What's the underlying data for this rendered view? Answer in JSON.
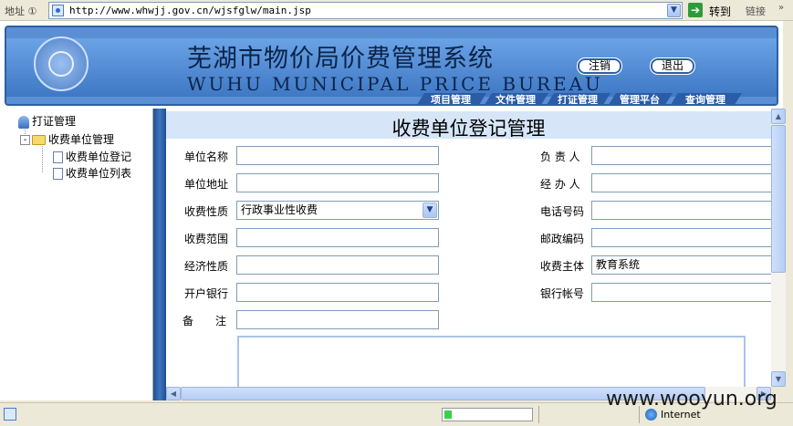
{
  "address_bar": {
    "label": "地址 ①",
    "url": "http://www.whwjj.gov.cn/wjsfglw/main.jsp",
    "go_label": "转到",
    "links_label": "链接"
  },
  "header": {
    "title": "芜湖市物价局价费管理系统",
    "subtitle": "WUHU MUNICIPAL PRICE BUREAU",
    "logout_label": "注销",
    "exit_label": "退出",
    "tabs": [
      "项目管理",
      "文件管理",
      "打证管理",
      "管理平台",
      "查询管理"
    ]
  },
  "nav": {
    "root_label": "打证管理",
    "group_toggle": "-",
    "group_label": "收费单位管理",
    "items": [
      "收费单位登记",
      "收费单位列表"
    ]
  },
  "form": {
    "title": "收费单位登记管理",
    "fields": {
      "unit_name_label": "单位名称",
      "unit_address_label": "单位地址",
      "fee_nature_label": "收费性质",
      "fee_nature_value": "行政事业性收费",
      "fee_scope_label": "收费范围",
      "economic_nature_label": "经济性质",
      "bank_label": "开户银行",
      "notes_label": "备　　注",
      "person_in_charge_label": "负 责 人",
      "handler_label": "经 办 人",
      "phone_label": "电话号码",
      "postcode_label": "邮政编码",
      "fee_subject_label": "收费主体",
      "fee_subject_value": "教育系统",
      "bank_account_label": "银行帐号"
    }
  },
  "status_bar": {
    "zone": "Internet",
    "progress": 0.08
  },
  "watermark": "www.wooyun.org"
}
